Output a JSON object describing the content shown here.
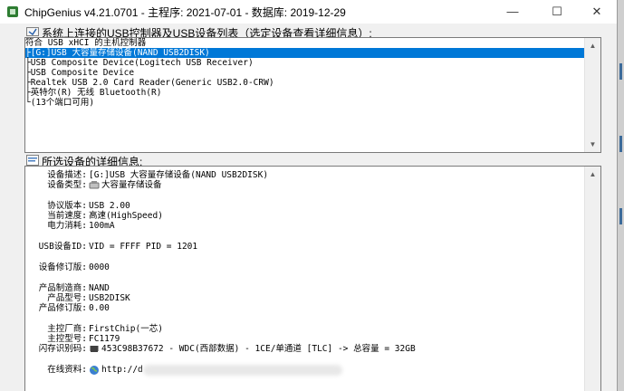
{
  "window": {
    "title": "ChipGenius v4.21.0701 - 主程序: 2021-07-01 - 数据库: 2019-12-29",
    "minimize": "—",
    "maximize": "☐",
    "close": "✕"
  },
  "devices_panel": {
    "label": "系统上连接的USB控制器及USB设备列表（选定设备查看详细信息）:",
    "items": [
      "符合 USB xHCI 的主机控制器",
      "├[G:]USB 大容量存储设备(NAND USB2DISK)",
      "├USB Composite Device(Logitech USB Receiver)",
      "├USB Composite Device",
      "├Realtek USB 2.0 Card Reader(Generic USB2.0-CRW)",
      "├英特尔(R) 无线 Bluetooth(R)",
      "└(13个端口可用)"
    ],
    "selected_index": 1
  },
  "details_panel": {
    "label": "所选设备的详细信息:",
    "rows": [
      {
        "label": "设备描述:",
        "value": "[G:]USB 大容量存储设备(NAND USB2DISK)"
      },
      {
        "label": "设备类型:",
        "value": "大容量存储设备"
      },
      {
        "label": "协议版本:",
        "value": "USB 2.00"
      },
      {
        "label": "当前速度:",
        "value": "高速(HighSpeed)"
      },
      {
        "label": "电力消耗:",
        "value": "100mA"
      },
      {
        "label": "USB设备ID:",
        "value": "VID = FFFF PID = 1201"
      },
      {
        "label": "设备修订版:",
        "value": "0000"
      },
      {
        "label": "产品制造商:",
        "value": "NAND"
      },
      {
        "label": "产品型号:",
        "value": "USB2DISK"
      },
      {
        "label": "产品修订版:",
        "value": "0.00"
      },
      {
        "label": "主控厂商:",
        "value": "FirstChip(一芯)"
      },
      {
        "label": "主控型号:",
        "value": "FC1179"
      },
      {
        "label": "闪存识别码:",
        "value": "453C98B37672 - WDC(西部数据) - 1CE/单通道 [TLC] -> 总容量 = 32GB"
      },
      {
        "label": "在线资料:",
        "value": "http://d"
      }
    ]
  }
}
